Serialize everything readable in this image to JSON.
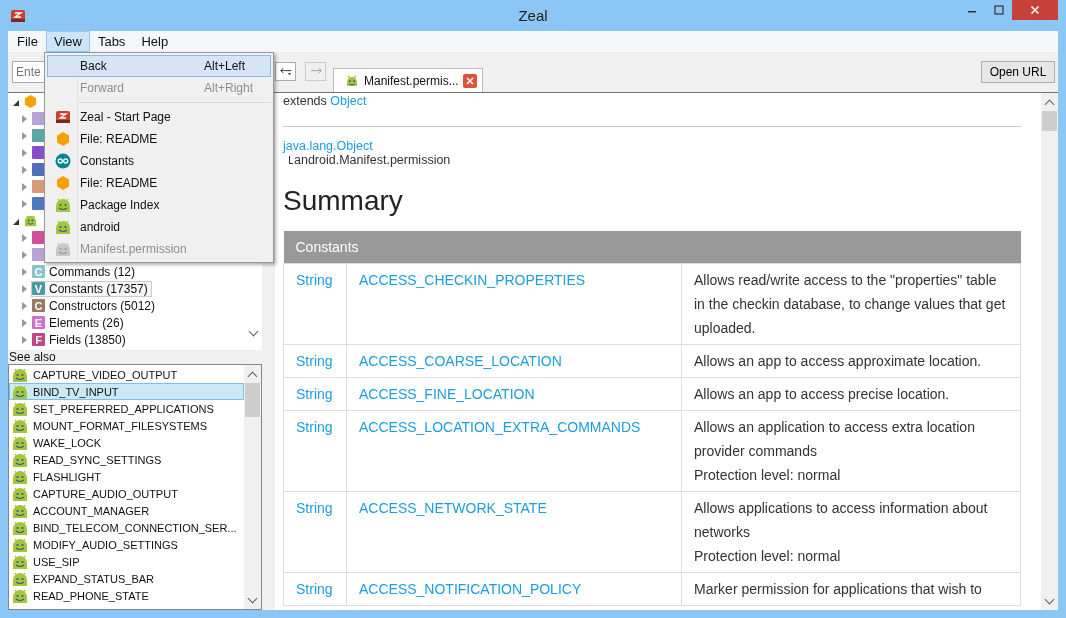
{
  "window": {
    "title": "Zeal"
  },
  "menu_bar": [
    {
      "label": "File",
      "selected": false
    },
    {
      "label": "View",
      "selected": true
    },
    {
      "label": "Tabs",
      "selected": false
    },
    {
      "label": "Help",
      "selected": false
    }
  ],
  "view_menu": [
    {
      "kind": "action",
      "label": "Back",
      "shortcut": "Alt+Left",
      "disabled": false,
      "selected": true
    },
    {
      "kind": "action",
      "label": "Forward",
      "shortcut": "Alt+Right",
      "disabled": true,
      "selected": false
    },
    {
      "kind": "separator"
    },
    {
      "kind": "start_page",
      "label": "Zeal - Start Page",
      "disabled": false,
      "selected": false
    },
    {
      "kind": "readme",
      "label": "File: README",
      "disabled": false,
      "selected": false
    },
    {
      "kind": "constants",
      "label": "Constants",
      "disabled": false,
      "selected": false
    },
    {
      "kind": "readme",
      "label": "File: README",
      "disabled": false,
      "selected": false
    },
    {
      "kind": "android",
      "label": "Package Index",
      "disabled": false,
      "selected": false
    },
    {
      "kind": "android",
      "label": "android",
      "disabled": false,
      "selected": false
    },
    {
      "kind": "android",
      "label": "Manifest.permission",
      "disabled": true,
      "selected": false
    }
  ],
  "search": {
    "placeholder": "Ente"
  },
  "tab": {
    "title": "Manifest.permis..."
  },
  "open_url_button": "Open URL",
  "tree": [
    {
      "kind": "readme",
      "expanded": true,
      "children": [
        {
          "color": "#b7a2d8",
          "selected": false
        },
        {
          "color": "#5aa5a8",
          "selected": false
        },
        {
          "color": "#8a4fc8",
          "selected": false
        },
        {
          "color": "#4f6fb8",
          "selected": false
        },
        {
          "color": "#d89a78",
          "selected": false
        },
        {
          "color": "#5078c0",
          "selected": false
        }
      ]
    },
    {
      "kind": "android",
      "expanded": true,
      "children": [
        {
          "color": "#d0509a",
          "selected": false
        },
        {
          "color": "#b7a2d8",
          "selected": false
        },
        {
          "letter": "C",
          "label": "Commands (12)",
          "color": "#8cc4cc",
          "selected": false
        },
        {
          "letter": "V",
          "label": "Constants (17357)",
          "color": "#4a9aa8",
          "selected": true
        },
        {
          "letter": "C",
          "label": "Constructors (5012)",
          "color": "#9a7a68",
          "selected": false
        },
        {
          "letter": "E",
          "label": "Elements (26)",
          "color": "#d070c8",
          "selected": false
        },
        {
          "letter": "F",
          "label": "Fields (13850)",
          "color": "#c04888",
          "selected": false
        }
      ]
    }
  ],
  "see_also": {
    "title": "See also",
    "items": [
      {
        "label": "CAPTURE_VIDEO_OUTPUT",
        "selected": false
      },
      {
        "label": "BIND_TV_INPUT",
        "selected": true
      },
      {
        "label": "SET_PREFERRED_APPLICATIONS",
        "selected": false
      },
      {
        "label": "MOUNT_FORMAT_FILESYSTEMS",
        "selected": false
      },
      {
        "label": "WAKE_LOCK",
        "selected": false
      },
      {
        "label": "READ_SYNC_SETTINGS",
        "selected": false
      },
      {
        "label": "FLASHLIGHT",
        "selected": false
      },
      {
        "label": "CAPTURE_AUDIO_OUTPUT",
        "selected": false
      },
      {
        "label": "ACCOUNT_MANAGER",
        "selected": false
      },
      {
        "label": "BIND_TELECOM_CONNECTION_SER...",
        "selected": false
      },
      {
        "label": "MODIFY_AUDIO_SETTINGS",
        "selected": false
      },
      {
        "label": "USE_SIP",
        "selected": false
      },
      {
        "label": "EXPAND_STATUS_BAR",
        "selected": false
      },
      {
        "label": "READ_PHONE_STATE",
        "selected": false
      }
    ]
  },
  "page": {
    "extends_label": "extends",
    "extends_link": "Object",
    "parent_class": "java.lang.Object",
    "this_class": "android.Manifest.permission",
    "heading": "Summary",
    "table": {
      "title": "Constants",
      "rows": [
        {
          "type": "String",
          "name": "ACCESS_CHECKIN_PROPERTIES",
          "description": [
            "Allows read/write access to the \"properties\" table in the checkin database, to change values that get uploaded."
          ]
        },
        {
          "type": "String",
          "name": "ACCESS_COARSE_LOCATION",
          "description": [
            "Allows an app to access approximate location."
          ]
        },
        {
          "type": "String",
          "name": "ACCESS_FINE_LOCATION",
          "description": [
            "Allows an app to access precise location."
          ]
        },
        {
          "type": "String",
          "name": "ACCESS_LOCATION_EXTRA_COMMANDS",
          "description": [
            "Allows an application to access extra location provider commands",
            "Protection level: normal"
          ]
        },
        {
          "type": "String",
          "name": "ACCESS_NETWORK_STATE",
          "description": [
            "Allows applications to access information about networks",
            "Protection level: normal"
          ]
        },
        {
          "type": "String",
          "name": "ACCESS_NOTIFICATION_POLICY",
          "description": [
            "Marker permission for applications that wish to"
          ]
        }
      ]
    }
  }
}
